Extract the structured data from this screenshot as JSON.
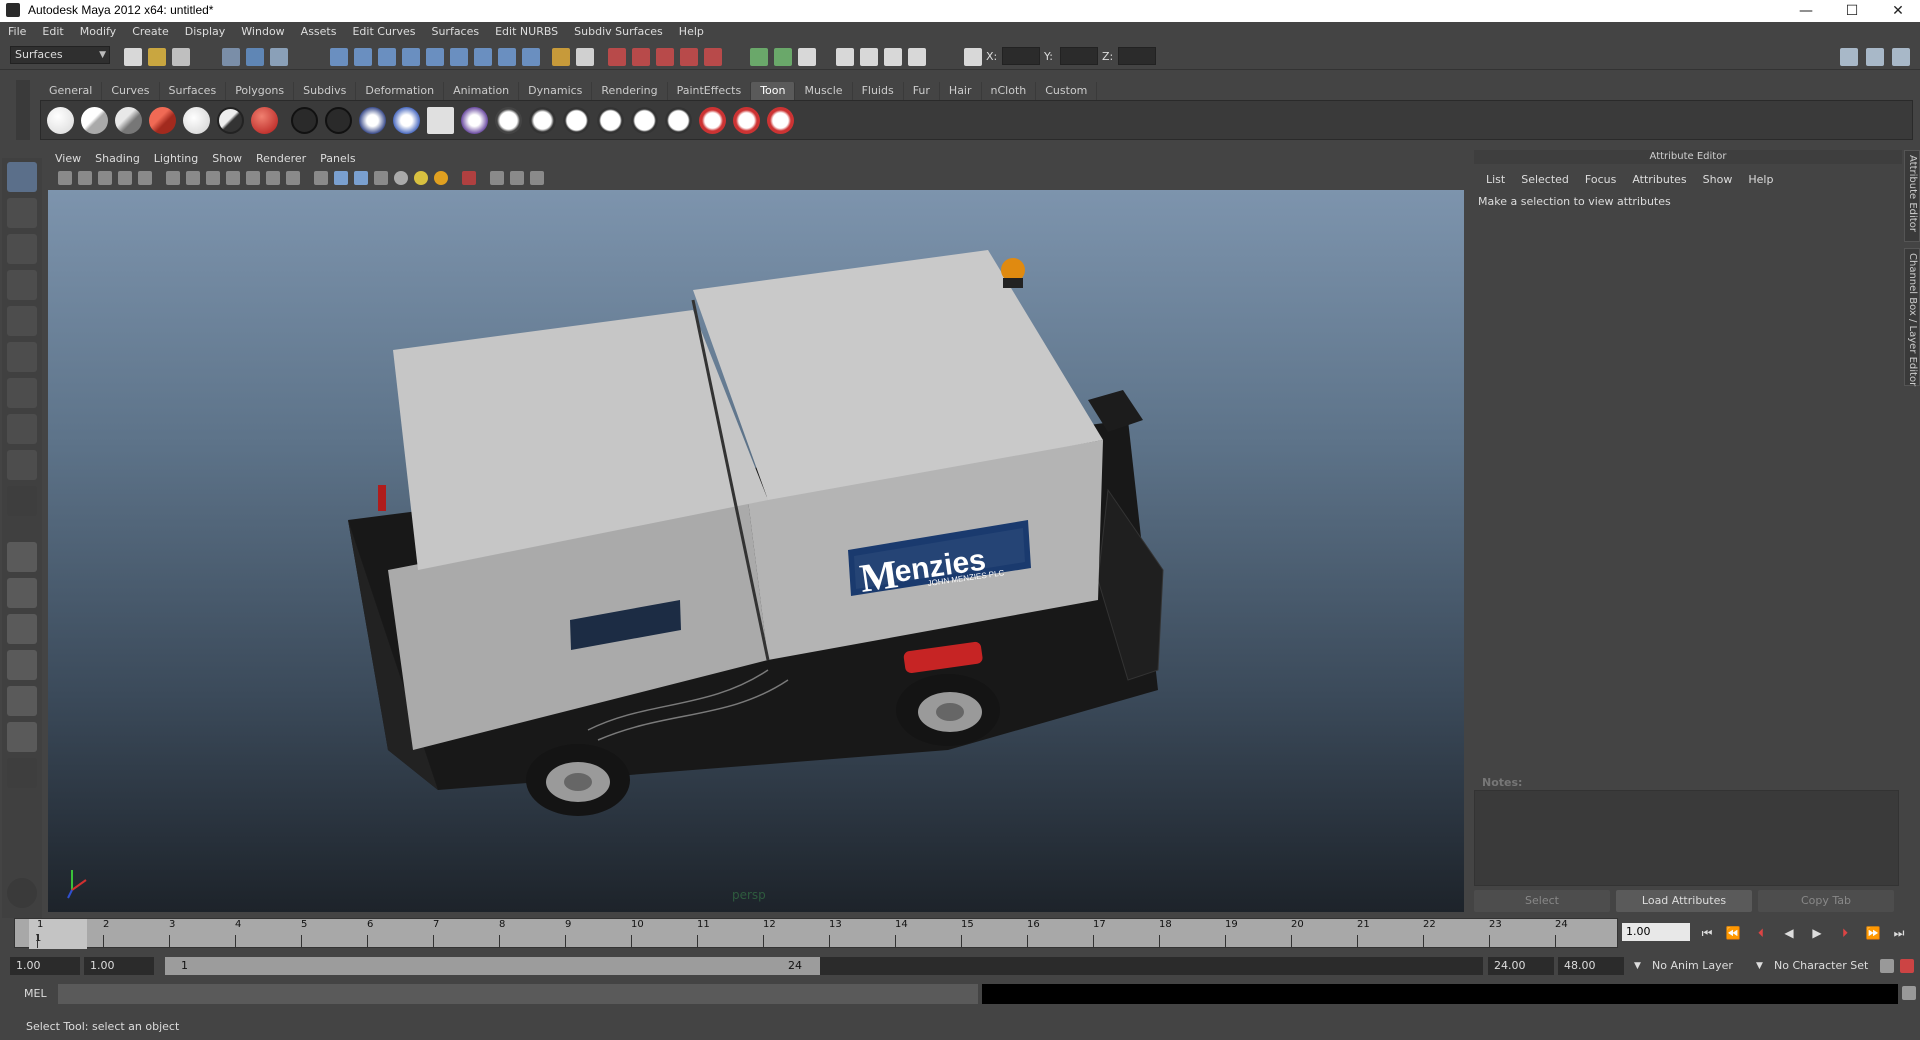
{
  "window": {
    "title": "Autodesk Maya 2012 x64: untitled*",
    "controls": [
      "—",
      "☐",
      "✕"
    ]
  },
  "menubar": [
    "File",
    "Edit",
    "Modify",
    "Create",
    "Display",
    "Window",
    "Assets",
    "Edit Curves",
    "Surfaces",
    "Edit NURBS",
    "Subdiv Surfaces",
    "Help"
  ],
  "statusline": {
    "mode": "Surfaces",
    "coord_labels": [
      "X:",
      "Y:",
      "Z:"
    ]
  },
  "shelf": {
    "tabs": [
      "General",
      "Curves",
      "Surfaces",
      "Polygons",
      "Subdivs",
      "Deformation",
      "Animation",
      "Dynamics",
      "Rendering",
      "PaintEffects",
      "Toon",
      "Muscle",
      "Fluids",
      "Fur",
      "Hair",
      "nCloth",
      "Custom"
    ],
    "active_tab": "Toon"
  },
  "panel": {
    "menus": [
      "View",
      "Shading",
      "Lighting",
      "Show",
      "Renderer",
      "Panels"
    ],
    "camera": "persp",
    "logo_text": "enzies",
    "logo_sub": "JOHN MENZIES PLC"
  },
  "attribute_editor": {
    "header": "Attribute Editor",
    "menus": [
      "List",
      "Selected",
      "Focus",
      "Attributes",
      "Show",
      "Help"
    ],
    "message": "Make a selection to view attributes",
    "notes_label": "Notes:",
    "buttons": {
      "select": "Select",
      "load": "Load Attributes",
      "copy": "Copy Tab"
    }
  },
  "side_tabs": [
    "Attribute Editor",
    "Channel Box / Layer Editor"
  ],
  "timeline": {
    "ticks": [
      "1",
      "2",
      "3",
      "4",
      "5",
      "6",
      "7",
      "8",
      "9",
      "10",
      "11",
      "12",
      "13",
      "14",
      "15",
      "16",
      "17",
      "18",
      "19",
      "20",
      "21",
      "22",
      "23",
      "24"
    ],
    "current_frame": "1",
    "current_time": "1.00"
  },
  "range": {
    "start": "1.00",
    "playback_start": "1.00",
    "slider_start": "1",
    "slider_end": "24",
    "playback_end": "24.00",
    "end": "48.00",
    "anim_layer": "No Anim Layer",
    "character_set": "No Character Set"
  },
  "command_line": {
    "label": "MEL"
  },
  "help_line": "Select Tool: select an object",
  "colors": {
    "bg": "#444444",
    "viewport_top": "#7d94ad",
    "viewport_bottom": "#1d232a",
    "menzies_blue": "#1a3a6e"
  }
}
